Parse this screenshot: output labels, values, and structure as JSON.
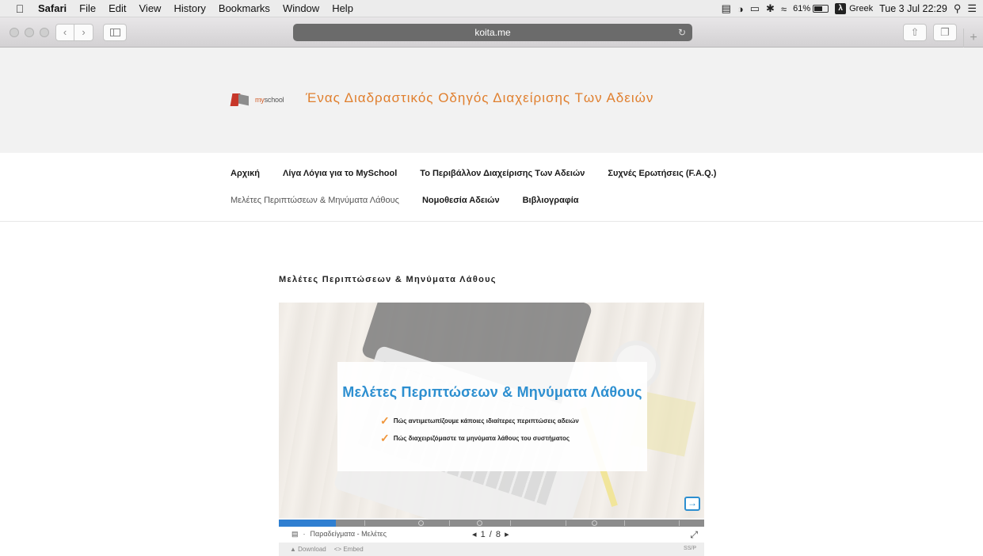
{
  "menubar": {
    "apple_icon": "apple-icon",
    "app_name": "Safari",
    "items": [
      "File",
      "Edit",
      "View",
      "History",
      "Bookmarks",
      "Window",
      "Help"
    ],
    "battery": "61%",
    "input_source": "Greek",
    "input_badge": "λ",
    "datetime": "Tue 3 Jul  22:29"
  },
  "safari": {
    "url": "koita.me"
  },
  "site": {
    "logo_brand": "my",
    "logo_brand2": "school",
    "title": "Ένας Διαδραστικός Οδηγός Διαχείρισης Των Αδειών"
  },
  "nav": {
    "row1": [
      "Αρχική",
      "Λίγα Λόγια για το MySchool",
      "Το Περιβάλλον Διαχείρισης Των Αδειών",
      "Συχνές Ερωτήσεις (F.A.Q.)"
    ],
    "row2": [
      "Μελέτες Περιπτώσεων & Μηνύματα Λάθους",
      "Νομοθεσία Αδειών",
      "Βιβλιογραφία"
    ]
  },
  "content": {
    "heading": "Μελέτες Περιπτώσεων & Μηνύματα Λάθους"
  },
  "slideshow": {
    "slide_title": "Μελέτες Περιπτώσεων & Μηνύματα Λάθους",
    "bullets": [
      "Πώς αντιμετωπίζουμε κάποιες ιδιαίτερες περιπτώσεις αδειών",
      "Πώς διαχειριζόμαστε τα μηνύματα λάθους του συστήματος"
    ],
    "deck_label": "Παραδείγματα - Μελέτες",
    "current_slide": "1",
    "total_slides": "8",
    "progress_fraction": 0.135,
    "download_label": "Download",
    "embed_label": "Embed",
    "brand_mark": "SS/P"
  }
}
